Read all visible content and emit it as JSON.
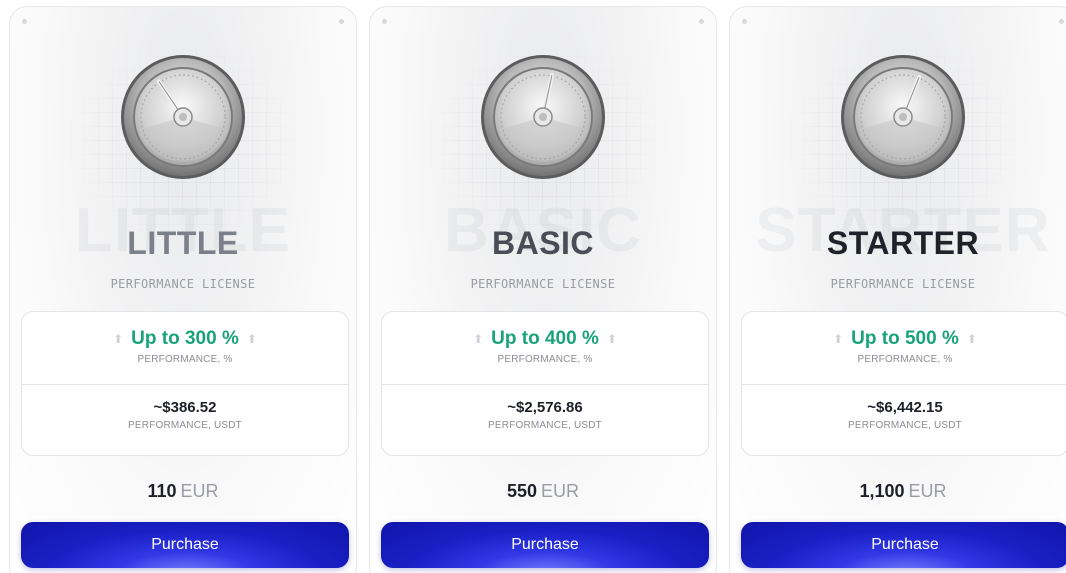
{
  "cards": [
    {
      "name": "LITTLE",
      "ghost": "LITTLE",
      "name_color": "#7d808a",
      "subtitle": "PERFORMANCE LICENSE",
      "performance_pct": "Up to 300 %",
      "performance_pct_label": "PERFORMANCE, %",
      "performance_usdt": "~$386.52",
      "performance_usdt_label": "PERFORMANCE, USDT",
      "price_amount": "110",
      "price_currency": "EUR",
      "button_label": "Purchase",
      "gauge_needle_angle_deg": -34
    },
    {
      "name": "BASIC",
      "ghost": "BASIC",
      "name_color": "#4a4d56",
      "subtitle": "PERFORMANCE LICENSE",
      "performance_pct": "Up to 400 %",
      "performance_pct_label": "PERFORMANCE, %",
      "performance_usdt": "~$2,576.86",
      "performance_usdt_label": "PERFORMANCE, USDT",
      "price_amount": "550",
      "price_currency": "EUR",
      "button_label": "Purchase",
      "gauge_needle_angle_deg": 12
    },
    {
      "name": "STARTER",
      "ghost": "STARTER",
      "name_color": "#20222a",
      "subtitle": "PERFORMANCE LICENSE",
      "performance_pct": "Up to 500 %",
      "performance_pct_label": "PERFORMANCE, %",
      "performance_usdt": "~$6,442.15",
      "performance_usdt_label": "PERFORMANCE, USDT",
      "price_amount": "1,100",
      "price_currency": "EUR",
      "button_label": "Purchase",
      "gauge_needle_angle_deg": 22
    }
  ],
  "colors": {
    "accent_green": "#1aa37a",
    "button_blue": "#1a1fc4",
    "muted_text": "#9a9ca4"
  },
  "icons": {
    "arrow": "arrow-up-icon",
    "gauge": "speedometer-gauge-icon"
  }
}
